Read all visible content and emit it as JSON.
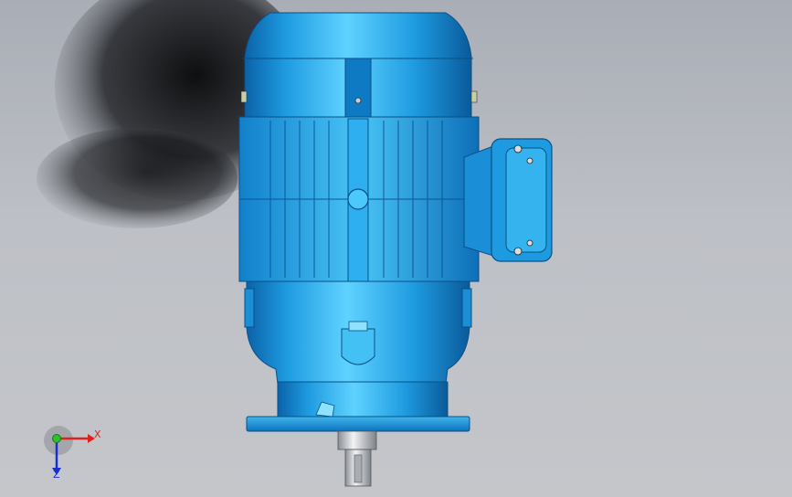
{
  "viewport": {
    "background_top": "#a9adb5",
    "background_bottom": "#c4c6ca",
    "model_color": "#1e9be0",
    "model_highlight": "#5fd2ff",
    "model_shadow": "#0b62a8"
  },
  "triad": {
    "x_label": "X",
    "z_label": "Z",
    "x_color": "#e0201c",
    "y_color": "#2fbf2f",
    "z_color": "#1a2fd0"
  }
}
